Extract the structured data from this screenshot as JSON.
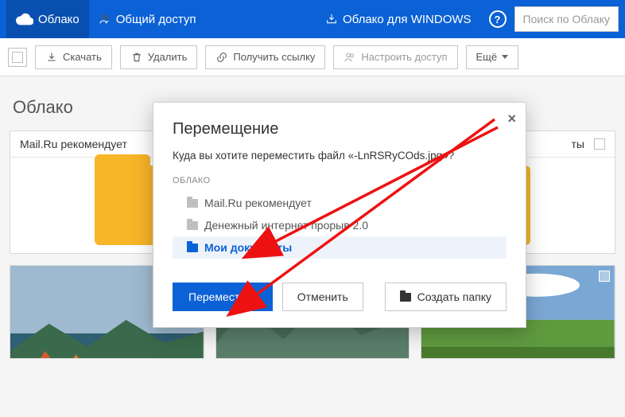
{
  "topbar": {
    "cloud_label": "Облако",
    "shared_label": "Общий доступ",
    "windows_label": "Облако для WINDOWS",
    "search_placeholder": "Поиск по Облаку"
  },
  "toolbar": {
    "download": "Скачать",
    "delete": "Удалить",
    "get_link": "Получить ссылку",
    "configure_access": "Настроить доступ",
    "more": "Ещё"
  },
  "section": {
    "title": "Облако",
    "card1_title": "Mail.Ru рекомендует",
    "card2_title_suffix": "ты"
  },
  "modal": {
    "title": "Перемещение",
    "prompt": "Куда вы хотите переместить файл «-LnRSRyCOds.jpg»?",
    "tree_label": "ОБЛАКО",
    "items": [
      "Mail.Ru рекомендует",
      "Денежный интернет прорыв 2.0",
      "Мои документы"
    ],
    "move_btn": "Переместить",
    "cancel_btn": "Отменить",
    "create_folder_btn": "Создать папку",
    "close": "×"
  }
}
